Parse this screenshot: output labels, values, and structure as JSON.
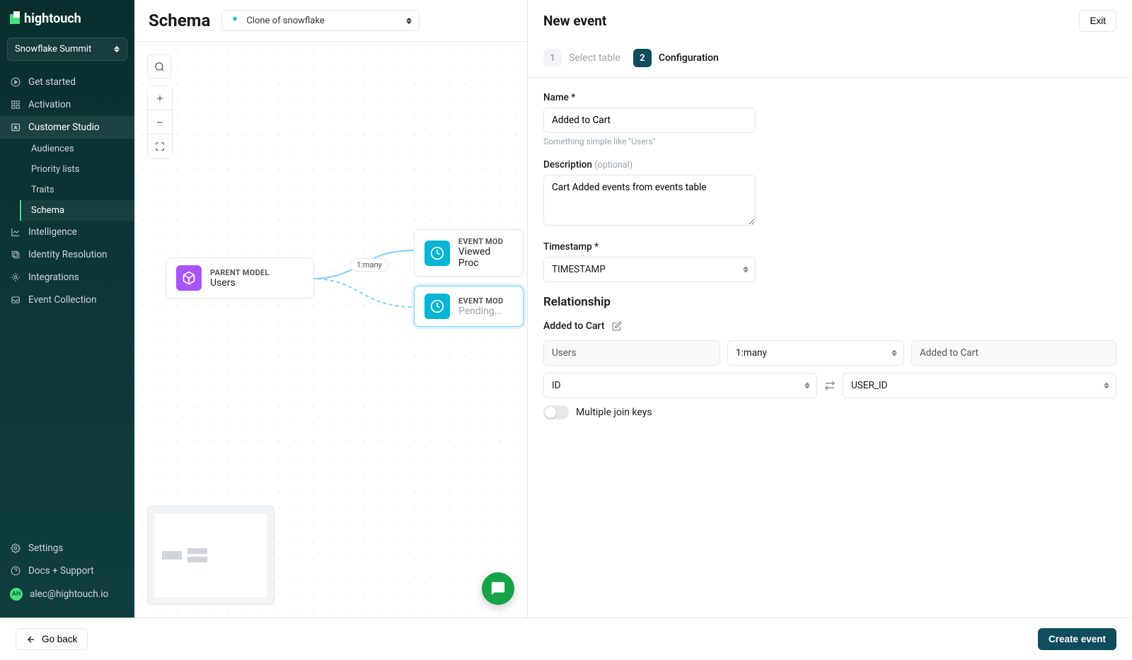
{
  "brand": "hightouch",
  "workspace": "Snowflake Summit",
  "nav": {
    "get_started": "Get started",
    "activation": "Activation",
    "customer_studio": "Customer Studio",
    "cs_items": {
      "audiences": "Audiences",
      "priority_lists": "Priority lists",
      "traits": "Traits",
      "schema": "Schema"
    },
    "intelligence": "Intelligence",
    "identity_resolution": "Identity Resolution",
    "integrations": "Integrations",
    "event_collection": "Event Collection",
    "settings": "Settings",
    "docs_support": "Docs + Support",
    "user_email": "alec@hightouch.io",
    "user_initials": "AH"
  },
  "page_title": "Schema",
  "source_selector": "Clone of snowflake",
  "canvas": {
    "edge_label": "1:many",
    "parent": {
      "kicker": "PARENT MODEL",
      "title": "Users"
    },
    "event1": {
      "kicker": "EVENT MOD",
      "title": "Viewed Proc"
    },
    "event2": {
      "kicker": "EVENT MOD",
      "title": "Pending..."
    }
  },
  "panel": {
    "title": "New event",
    "exit": "Exit",
    "step1_label": "Select table",
    "step2_label": "Configuration",
    "name_label": "Name *",
    "name_value": "Added to Cart",
    "name_hint": "Something simple like \"Users\"",
    "desc_label": "Description",
    "desc_optional": "(optional)",
    "desc_value": "Cart Added events from events table",
    "ts_label": "Timestamp *",
    "ts_value": "TIMESTAMP",
    "rel_heading": "Relationship",
    "rel_name": "Added to Cart",
    "rel_from": "Users",
    "rel_cardinality": "1:many",
    "rel_to": "Added to Cart",
    "rel_from_key": "ID",
    "rel_to_key": "USER_ID",
    "multi_join": "Multiple join keys",
    "go_back": "Go back",
    "create": "Create event"
  }
}
